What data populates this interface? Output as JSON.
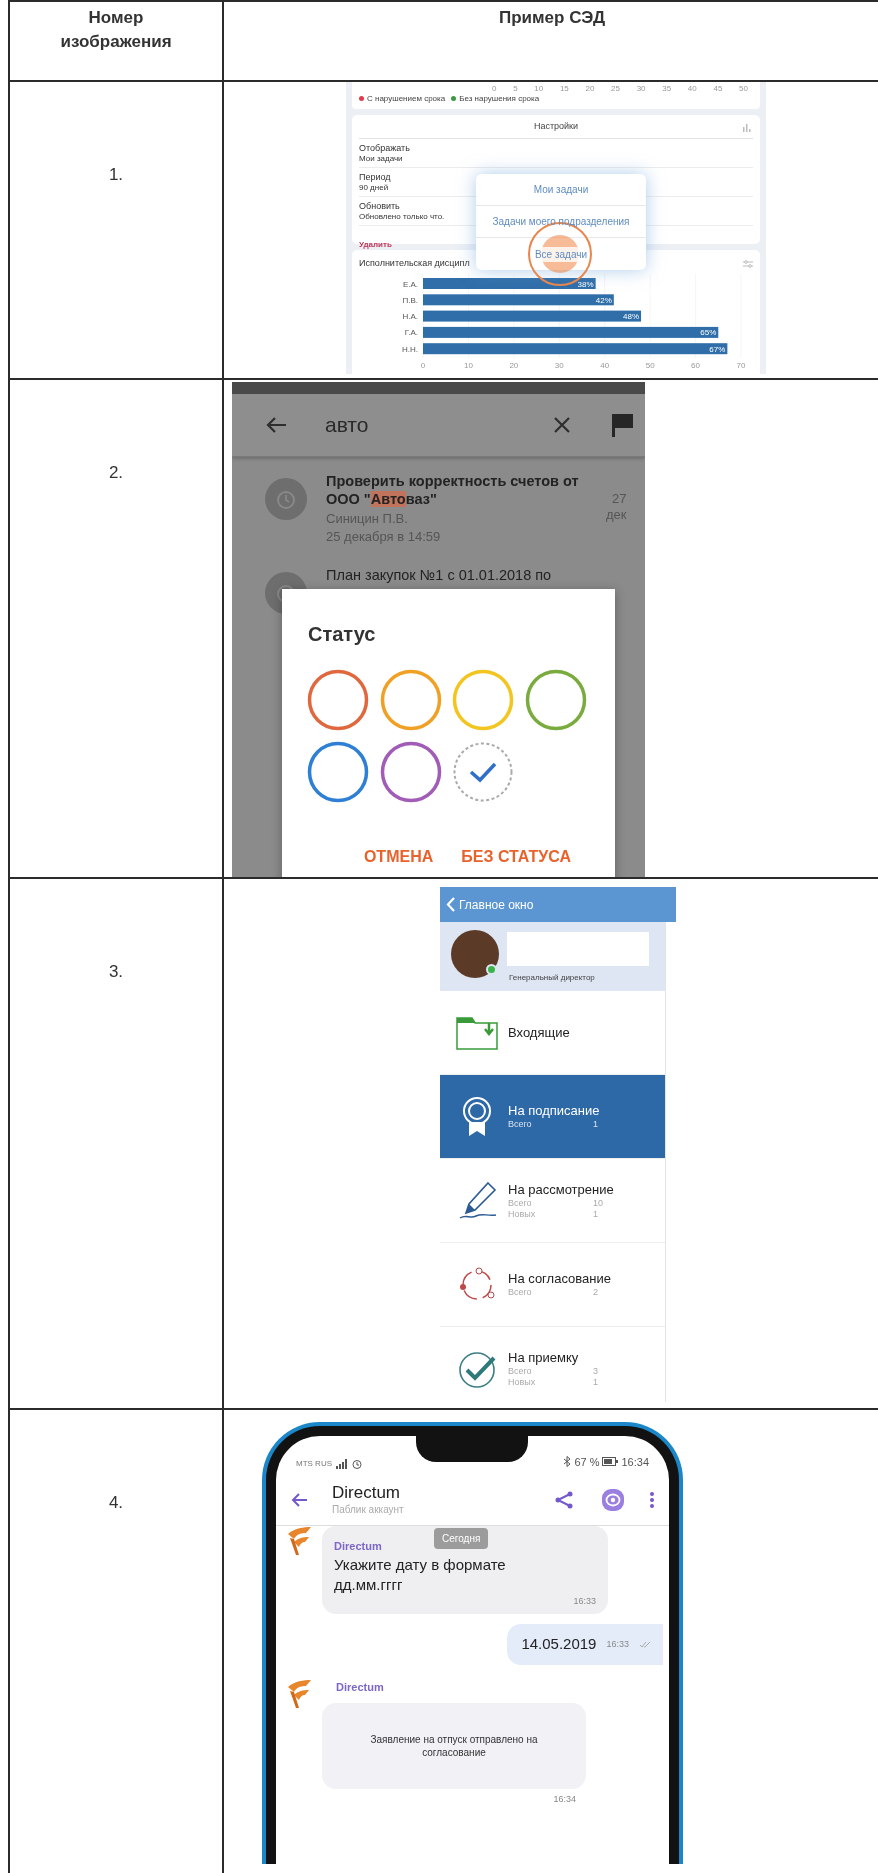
{
  "table": {
    "columns": [
      "Номер изображения",
      "Пример СЭД"
    ],
    "rows": [
      {
        "number": "1.",
        "screenshot": {
          "kind": "dashboard",
          "axis_labels": [
            "0",
            "5",
            "10",
            "15",
            "20",
            "25",
            "30",
            "35",
            "40",
            "45",
            "50"
          ],
          "legend": [
            {
              "label": "С нарушением срока",
              "color": "#e23b4a"
            },
            {
              "label": "Без нарушения срока",
              "color": "#3c9a40"
            }
          ],
          "settings": {
            "title": "Настройки",
            "rows": [
              {
                "label": "Отображать",
                "value": "Мои задачи"
              },
              {
                "label": "Период",
                "value": "90 дней"
              },
              {
                "label": "Обновить",
                "value": "Обновлено только что."
              }
            ],
            "delete": "Удалить"
          },
          "menu": [
            "Мои задачи",
            "Задачи моего подразделения",
            "Все задачи"
          ],
          "chart": {
            "title": "Исполнительская дисципл",
            "chart_data": {
              "type": "bar",
              "orientation": "horizontal",
              "categories": [
                "Е.А.",
                "П.В.",
                "Н.А.",
                "Г.А.",
                "Н.Н."
              ],
              "values": [
                38,
                42,
                48,
                65,
                67
              ],
              "xticks": [
                0,
                10,
                20,
                30,
                40,
                50,
                60,
                70
              ],
              "xlim": [
                0,
                70
              ],
              "grid": true,
              "value_labels": [
                "38%",
                "42%",
                "48%",
                "65%",
                "67%"
              ]
            }
          }
        }
      },
      {
        "number": "2.",
        "screenshot": {
          "kind": "status_dialog",
          "search": "авто",
          "results": [
            {
              "title_start": "Проверить корректность счетов от ООО \"",
              "highlight": "Авто",
              "title_end": "ваз\"",
              "author": "Синицин П.В.",
              "date": "25 декабря в 14:59",
              "day": "27",
              "month": "дек"
            },
            {
              "title_start": "План закупок №1 с 01.01.2018 по"
            }
          ],
          "dialog": {
            "title": "Статус",
            "statuses": [
              {
                "kind": "color",
                "color": "#e0683e",
                "selected": false
              },
              {
                "kind": "color",
                "color": "#f0a024",
                "selected": false
              },
              {
                "kind": "color",
                "color": "#f2c521",
                "selected": false
              },
              {
                "kind": "color",
                "color": "#7aab3e",
                "selected": false
              },
              {
                "kind": "color",
                "color": "#2f7fd4",
                "selected": false
              },
              {
                "kind": "color",
                "color": "#a05cb6",
                "selected": false
              },
              {
                "kind": "none",
                "selected": true
              }
            ],
            "buttons": [
              "ОТМЕНА",
              "БЕЗ СТАТУСА"
            ]
          }
        }
      },
      {
        "number": "3.",
        "screenshot": {
          "kind": "menu",
          "back": "Главное окно",
          "profile": {
            "position": "Генеральный директор",
            "online": true
          },
          "items": [
            {
              "label": "Входящие",
              "selected": false
            },
            {
              "label": "На подписание",
              "selected": true,
              "counts": [
                {
                  "label": "Всего",
                  "value": "1"
                }
              ]
            },
            {
              "label": "На рассмотрение",
              "selected": false,
              "counts": [
                {
                  "label": "Всего",
                  "value": "10"
                },
                {
                  "label": "Новых",
                  "value": "1"
                }
              ]
            },
            {
              "label": "На согласование",
              "selected": false,
              "counts": [
                {
                  "label": "Всего",
                  "value": "2"
                }
              ]
            },
            {
              "label": "На приемку",
              "selected": false,
              "counts": [
                {
                  "label": "Всего",
                  "value": "3"
                },
                {
                  "label": "Новых",
                  "value": "1"
                }
              ]
            }
          ]
        }
      },
      {
        "number": "4.",
        "screenshot": {
          "kind": "chat",
          "status_bar": {
            "carrier": "MTS RUS",
            "battery": "67 %",
            "time": "16:34"
          },
          "title": "Directum",
          "subtitle": "Паблик аккаунт",
          "date_chip": "Сегодня",
          "messages": [
            {
              "kind": "incoming",
              "sender": "Directum",
              "text": "Укажите дату в формате дд.мм.гггг",
              "time": "16:33"
            },
            {
              "kind": "outgoing",
              "text": "14.05.2019",
              "time": "16:33"
            },
            {
              "kind": "card",
              "sender": "Directum",
              "text": "Заявление на отпуск отправлено на согласование",
              "time": "16:34"
            }
          ]
        }
      }
    ]
  }
}
